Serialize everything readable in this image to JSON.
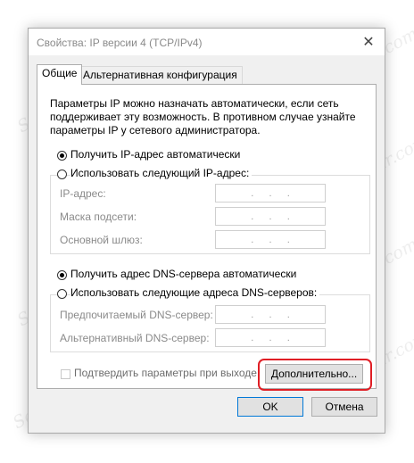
{
  "window": {
    "title": "Свойства: IP версии 4 (TCP/IPv4)",
    "close_icon": "close-icon"
  },
  "tabs": [
    {
      "label": "Общие",
      "active": true
    },
    {
      "label": "Альтернативная конфигурация",
      "active": false
    }
  ],
  "general": {
    "description": "Параметры IP можно назначать автоматически, если сеть поддерживает эту возможность. В противном случае узнайте параметры IP у сетевого администратора.",
    "ip_auto_label": "Получить IP-адрес автоматически",
    "ip_manual_label": "Использовать следующий IP-адрес:",
    "ip_address_label": "IP-адрес:",
    "subnet_mask_label": "Маска подсети:",
    "gateway_label": "Основной шлюз:",
    "dns_auto_label": "Получить адрес DNS-сервера автоматически",
    "dns_manual_label": "Использовать следующие адреса DNS-серверов:",
    "preferred_dns_label": "Предпочитаемый DNS-сервер:",
    "alternate_dns_label": "Альтернативный DNS-сервер:",
    "validate_label": "Подтвердить параметры при выходе",
    "advanced_button": "Дополнительно...",
    "ip_dot": "."
  },
  "footer": {
    "ok_button": "OK",
    "cancel_button": "Отмена"
  },
  "watermark_text": "Soringpcrepair.com",
  "colors": {
    "highlight": "#e01e25",
    "disabled_text": "#8a8a8a"
  }
}
